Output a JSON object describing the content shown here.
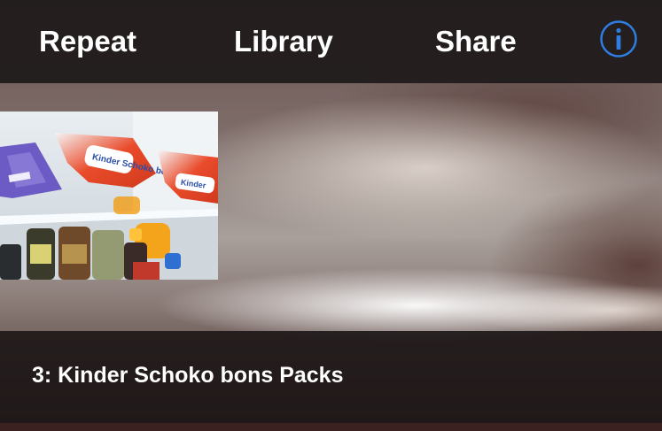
{
  "toolbar": {
    "repeat_label": "Repeat",
    "library_label": "Library",
    "share_label": "Share",
    "info_icon": "info-circle-icon",
    "accent_color": "#2f7de1"
  },
  "thumbnail": {
    "label_left": "Kinder Schoko bons",
    "label_right": "Kinder"
  },
  "caption": {
    "text": "3: Kinder Schoko bons Packs"
  }
}
